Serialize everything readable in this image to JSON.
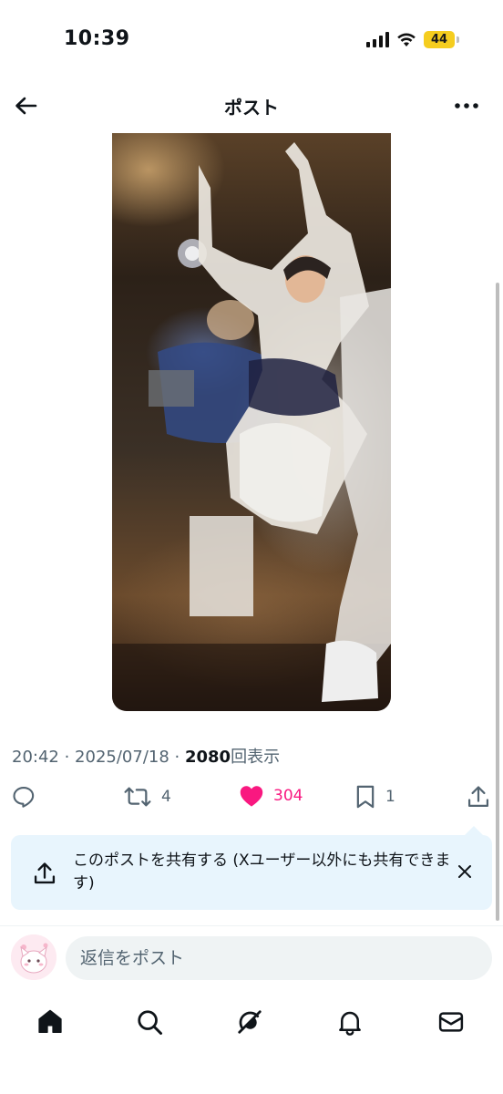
{
  "status_bar": {
    "time": "10:39",
    "battery_level": "44",
    "icons": [
      "signal-icon",
      "wifi-icon",
      "battery-icon"
    ]
  },
  "header": {
    "title": "ポスト",
    "back_icon": "back-arrow-icon",
    "more_icon": "more-options-icon"
  },
  "media": {
    "type": "photo"
  },
  "meta": {
    "time": "20:42",
    "separator": " · ",
    "date": "2025/07/18",
    "views": "2080",
    "views_suffix": "回表示"
  },
  "actions": {
    "reply": {
      "icon": "reply-icon"
    },
    "repost": {
      "icon": "repost-icon",
      "count": "4"
    },
    "like": {
      "icon": "heart-icon",
      "count": "304",
      "liked": true,
      "color": "#f91880"
    },
    "bookmark": {
      "icon": "bookmark-icon",
      "count": "1"
    },
    "share": {
      "icon": "share-icon"
    }
  },
  "share_banner": {
    "text": "このポストを共有する (Xユーザー以外にも共有できます)",
    "icon": "share-icon",
    "close_icon": "close-icon"
  },
  "reply_box": {
    "placeholder": "返信をポスト"
  },
  "bottom_nav": {
    "items": [
      {
        "name": "home",
        "icon": "home-icon",
        "active": true
      },
      {
        "name": "search",
        "icon": "search-icon"
      },
      {
        "name": "grok",
        "icon": "grok-icon"
      },
      {
        "name": "notifications",
        "icon": "bell-icon"
      },
      {
        "name": "messages",
        "icon": "mail-icon"
      }
    ]
  },
  "colors": {
    "text": "#0f1419",
    "secondary": "#536471",
    "like": "#f91880",
    "banner_bg": "#e8f5fd"
  }
}
